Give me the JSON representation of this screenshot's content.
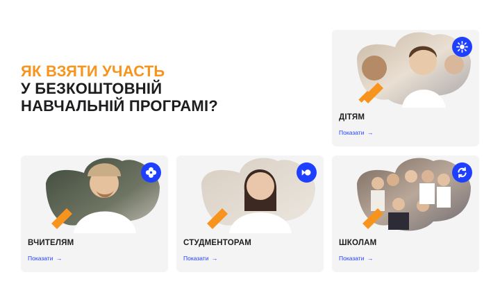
{
  "heading": {
    "line1": "Як взяти участь",
    "line2": "у безкоштовній",
    "line3": "навчальній програмі?"
  },
  "colors": {
    "accent_orange": "#F7941D",
    "accent_blue": "#1F3FFF",
    "card_bg": "#F4F4F4"
  },
  "cards": [
    {
      "title": "Дітям",
      "link": "Показати",
      "icon": "sun-icon"
    },
    {
      "title": "Вчителям",
      "link": "Показати",
      "icon": "plus-flower-icon"
    },
    {
      "title": "Студменторам",
      "link": "Показати",
      "icon": "fish-icon"
    },
    {
      "title": "Школам",
      "link": "Показати",
      "icon": "refresh-icon"
    }
  ]
}
